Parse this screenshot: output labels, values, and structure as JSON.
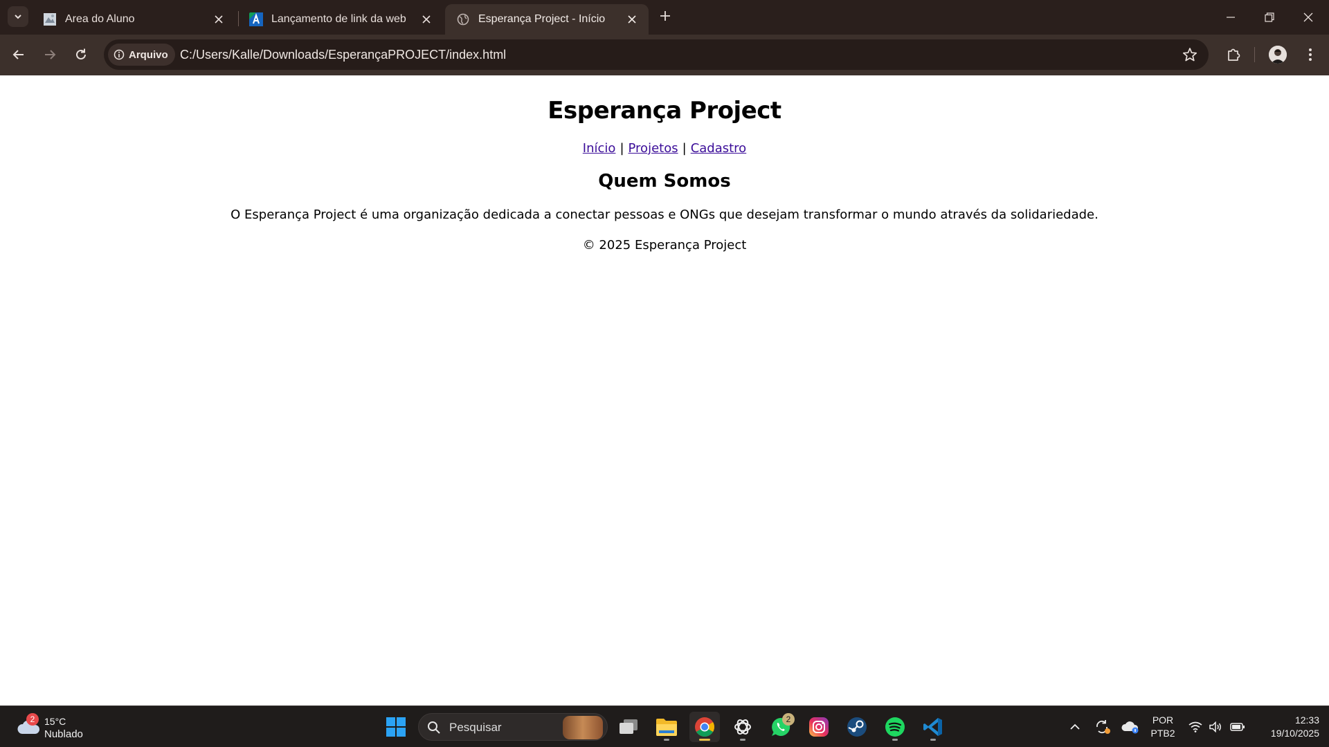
{
  "browser": {
    "tabs": [
      {
        "title": "Area do Aluno",
        "favicon": "student-area-favicon"
      },
      {
        "title": "Lançamento de link da web",
        "favicon": "ava-favicon"
      },
      {
        "title": "Esperança Project - Início",
        "favicon": "globe-icon",
        "active": true
      }
    ],
    "chip_label": "Arquivo",
    "url": "C:/Users/Kalle/Downloads/EsperançaPROJECT/index.html"
  },
  "page": {
    "title": "Esperança Project",
    "nav": [
      {
        "label": "Início"
      },
      {
        "label": "Projetos"
      },
      {
        "label": "Cadastro"
      }
    ],
    "nav_separator": "|",
    "section_heading": "Quem Somos",
    "section_text": "O Esperança Project é uma organização dedicada a conectar pessoas e ONGs que desejam transformar o mundo através da solidariedade.",
    "footer": "© 2025 Esperança Project"
  },
  "taskbar": {
    "weather": {
      "badge": "2",
      "temp": "15°C",
      "condition": "Nublado"
    },
    "search_placeholder": "Pesquisar",
    "apps": [
      {
        "name": "start-icon"
      },
      {
        "name": "task-view-icon"
      },
      {
        "name": "file-explorer-icon"
      },
      {
        "name": "chrome-icon",
        "active": true
      },
      {
        "name": "chatgpt-icon"
      },
      {
        "name": "whatsapp-icon",
        "badge": "2"
      },
      {
        "name": "instagram-icon"
      },
      {
        "name": "steam-icon"
      },
      {
        "name": "spotify-icon"
      },
      {
        "name": "vscode-icon"
      }
    ],
    "lang_line1": "POR",
    "lang_line2": "PTB2",
    "time": "12:33",
    "date": "19/10/2025"
  },
  "colors": {
    "tabstrip": "#2a1f1c",
    "toolbar": "#3c302b",
    "link": "#3b0d99",
    "taskbar": "#1f1c1b"
  }
}
